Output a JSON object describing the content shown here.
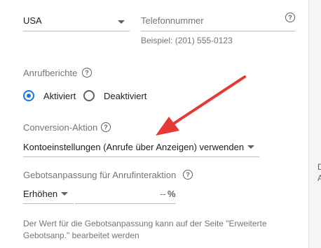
{
  "phone": {
    "country_value": "USA",
    "number_placeholder": "Telefonnummer",
    "example": "Beispiel: (201) 555-0123"
  },
  "call_reports": {
    "label": "Anrufberichte",
    "options": [
      "Aktiviert",
      "Deaktiviert"
    ],
    "selected": "Aktiviert"
  },
  "conversion": {
    "label": "Conversion-Aktion",
    "value": "Kontoeinstellungen (Anrufe über Anzeigen) verwenden"
  },
  "bid_adjustment": {
    "label": "Gebotsanpassung für Anrufinteraktion",
    "mode": "Erhöhen",
    "amount": "--",
    "unit": "%",
    "note_line1": "Der Wert für die Gebotsanpassung kann auf der Seite \"Erweiterte",
    "note_line2": "Gebotsanp.\" bearbeitet werden"
  },
  "right_edge": {
    "line1": "D",
    "line2": "A"
  },
  "colors": {
    "accent": "#1a73e8",
    "annotation_arrow": "#e53935"
  },
  "icons": [
    "help-icon",
    "dropdown-arrow-icon",
    "annotation-arrow"
  ]
}
